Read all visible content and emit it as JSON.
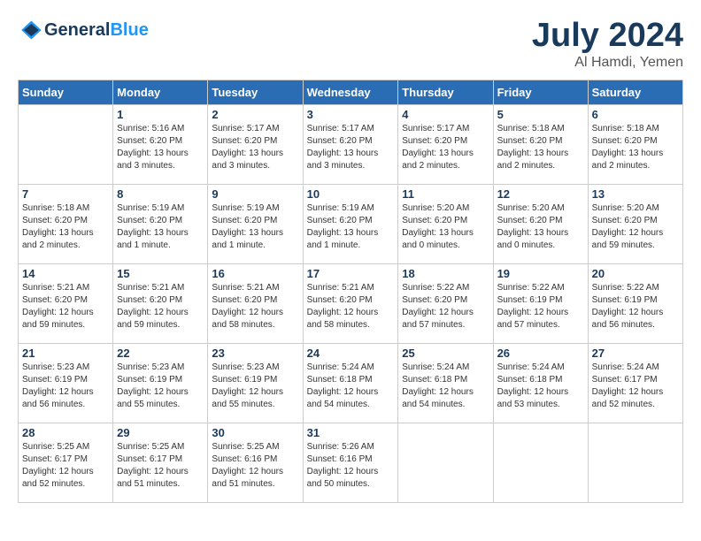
{
  "header": {
    "logo_line1": "General",
    "logo_line2": "Blue",
    "month_title": "July 2024",
    "location": "Al Hamdi, Yemen"
  },
  "columns": [
    "Sunday",
    "Monday",
    "Tuesday",
    "Wednesday",
    "Thursday",
    "Friday",
    "Saturday"
  ],
  "weeks": [
    [
      {
        "day": "",
        "info": ""
      },
      {
        "day": "1",
        "info": "Sunrise: 5:16 AM\nSunset: 6:20 PM\nDaylight: 13 hours\nand 3 minutes."
      },
      {
        "day": "2",
        "info": "Sunrise: 5:17 AM\nSunset: 6:20 PM\nDaylight: 13 hours\nand 3 minutes."
      },
      {
        "day": "3",
        "info": "Sunrise: 5:17 AM\nSunset: 6:20 PM\nDaylight: 13 hours\nand 3 minutes."
      },
      {
        "day": "4",
        "info": "Sunrise: 5:17 AM\nSunset: 6:20 PM\nDaylight: 13 hours\nand 2 minutes."
      },
      {
        "day": "5",
        "info": "Sunrise: 5:18 AM\nSunset: 6:20 PM\nDaylight: 13 hours\nand 2 minutes."
      },
      {
        "day": "6",
        "info": "Sunrise: 5:18 AM\nSunset: 6:20 PM\nDaylight: 13 hours\nand 2 minutes."
      }
    ],
    [
      {
        "day": "7",
        "info": "Sunrise: 5:18 AM\nSunset: 6:20 PM\nDaylight: 13 hours\nand 2 minutes."
      },
      {
        "day": "8",
        "info": "Sunrise: 5:19 AM\nSunset: 6:20 PM\nDaylight: 13 hours\nand 1 minute."
      },
      {
        "day": "9",
        "info": "Sunrise: 5:19 AM\nSunset: 6:20 PM\nDaylight: 13 hours\nand 1 minute."
      },
      {
        "day": "10",
        "info": "Sunrise: 5:19 AM\nSunset: 6:20 PM\nDaylight: 13 hours\nand 1 minute."
      },
      {
        "day": "11",
        "info": "Sunrise: 5:20 AM\nSunset: 6:20 PM\nDaylight: 13 hours\nand 0 minutes."
      },
      {
        "day": "12",
        "info": "Sunrise: 5:20 AM\nSunset: 6:20 PM\nDaylight: 13 hours\nand 0 minutes."
      },
      {
        "day": "13",
        "info": "Sunrise: 5:20 AM\nSunset: 6:20 PM\nDaylight: 12 hours\nand 59 minutes."
      }
    ],
    [
      {
        "day": "14",
        "info": "Sunrise: 5:21 AM\nSunset: 6:20 PM\nDaylight: 12 hours\nand 59 minutes."
      },
      {
        "day": "15",
        "info": "Sunrise: 5:21 AM\nSunset: 6:20 PM\nDaylight: 12 hours\nand 59 minutes."
      },
      {
        "day": "16",
        "info": "Sunrise: 5:21 AM\nSunset: 6:20 PM\nDaylight: 12 hours\nand 58 minutes."
      },
      {
        "day": "17",
        "info": "Sunrise: 5:21 AM\nSunset: 6:20 PM\nDaylight: 12 hours\nand 58 minutes."
      },
      {
        "day": "18",
        "info": "Sunrise: 5:22 AM\nSunset: 6:20 PM\nDaylight: 12 hours\nand 57 minutes."
      },
      {
        "day": "19",
        "info": "Sunrise: 5:22 AM\nSunset: 6:19 PM\nDaylight: 12 hours\nand 57 minutes."
      },
      {
        "day": "20",
        "info": "Sunrise: 5:22 AM\nSunset: 6:19 PM\nDaylight: 12 hours\nand 56 minutes."
      }
    ],
    [
      {
        "day": "21",
        "info": "Sunrise: 5:23 AM\nSunset: 6:19 PM\nDaylight: 12 hours\nand 56 minutes."
      },
      {
        "day": "22",
        "info": "Sunrise: 5:23 AM\nSunset: 6:19 PM\nDaylight: 12 hours\nand 55 minutes."
      },
      {
        "day": "23",
        "info": "Sunrise: 5:23 AM\nSunset: 6:19 PM\nDaylight: 12 hours\nand 55 minutes."
      },
      {
        "day": "24",
        "info": "Sunrise: 5:24 AM\nSunset: 6:18 PM\nDaylight: 12 hours\nand 54 minutes."
      },
      {
        "day": "25",
        "info": "Sunrise: 5:24 AM\nSunset: 6:18 PM\nDaylight: 12 hours\nand 54 minutes."
      },
      {
        "day": "26",
        "info": "Sunrise: 5:24 AM\nSunset: 6:18 PM\nDaylight: 12 hours\nand 53 minutes."
      },
      {
        "day": "27",
        "info": "Sunrise: 5:24 AM\nSunset: 6:17 PM\nDaylight: 12 hours\nand 52 minutes."
      }
    ],
    [
      {
        "day": "28",
        "info": "Sunrise: 5:25 AM\nSunset: 6:17 PM\nDaylight: 12 hours\nand 52 minutes."
      },
      {
        "day": "29",
        "info": "Sunrise: 5:25 AM\nSunset: 6:17 PM\nDaylight: 12 hours\nand 51 minutes."
      },
      {
        "day": "30",
        "info": "Sunrise: 5:25 AM\nSunset: 6:16 PM\nDaylight: 12 hours\nand 51 minutes."
      },
      {
        "day": "31",
        "info": "Sunrise: 5:26 AM\nSunset: 6:16 PM\nDaylight: 12 hours\nand 50 minutes."
      },
      {
        "day": "",
        "info": ""
      },
      {
        "day": "",
        "info": ""
      },
      {
        "day": "",
        "info": ""
      }
    ]
  ]
}
